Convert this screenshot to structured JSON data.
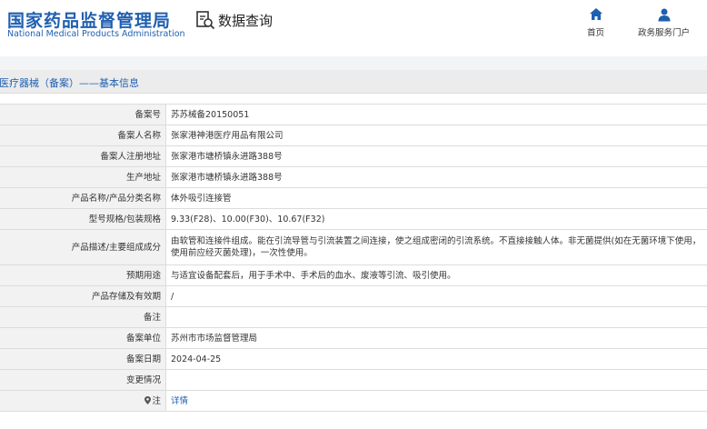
{
  "header": {
    "logo_cn": "国家药品监督管理局",
    "logo_en": "National Medical Products Administration",
    "search_label": "数据查询",
    "nav": {
      "home": "首页",
      "portal": "政务服务门户"
    }
  },
  "breadcrumb": "医疗器械（备案）——基本信息",
  "colors": {
    "brand_blue": "#1f5fb0",
    "label_bg": "#f2f2f2",
    "border": "#dcdcdc"
  },
  "rows": [
    {
      "label": "备案号",
      "value": "苏苏械备20150051"
    },
    {
      "label": "备案人名称",
      "value": "张家港神港医疗用品有限公司"
    },
    {
      "label": "备案人注册地址",
      "value": "张家港市塘桥镇永进路388号"
    },
    {
      "label": "生产地址",
      "value": "张家港市塘桥镇永进路388号"
    },
    {
      "label": "产品名称/产品分类名称",
      "value": "体外吸引连接管"
    },
    {
      "label": "型号规格/包装规格",
      "value": "9.33(F28)、10.00(F30)、10.67(F32)"
    },
    {
      "label": "产品描述/主要组成成分",
      "value": "由软管和连接件组成。能在引流导管与引流装置之间连接，使之组成密闭的引流系统。不直接接触人体。非无菌提供(如在无菌环境下使用，使用前应经灭菌处理)，一次性使用。"
    },
    {
      "label": "预期用途",
      "value": "与适宜设备配套后，用于手术中、手术后的血水、废液等引流、吸引使用。"
    },
    {
      "label": "产品存储及有效期",
      "value": "/"
    },
    {
      "label": "备注",
      "value": ""
    },
    {
      "label": "备案单位",
      "value": "苏州市市场监督管理局"
    },
    {
      "label": "备案日期",
      "value": "2024-04-25"
    },
    {
      "label": "变更情况",
      "value": ""
    },
    {
      "label": "注",
      "value": "详情"
    }
  ]
}
